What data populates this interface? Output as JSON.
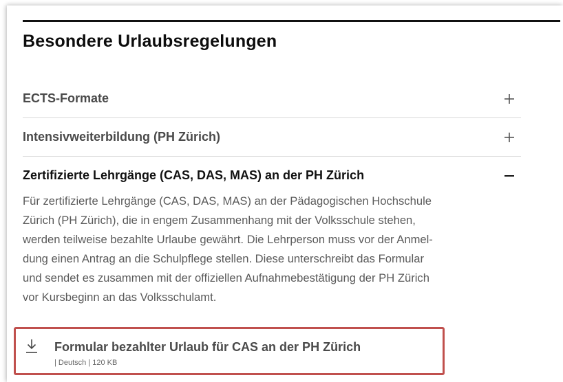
{
  "section": {
    "title": "Besondere Urlaubsregelungen"
  },
  "accordion": {
    "items": [
      {
        "label": "ECTS-Formate",
        "state": "collapsed",
        "toggle_icon": "plus-icon"
      },
      {
        "label": "Intensivweiterbildung (PH Zürich)",
        "state": "collapsed",
        "toggle_icon": "plus-icon"
      },
      {
        "label": "Zertifizierte Lehrgänge (CAS, DAS, MAS) an der PH Zürich",
        "state": "expanded",
        "toggle_icon": "minus-icon",
        "body_lines": [
          "Für zertifizierte Lehrgänge (CAS, DAS, MAS) an der Pädagogischen Hochschule",
          "Zürich (PH Zürich), die in engem Zusammenhang mit der Volksschule stehen,",
          "werden teilweise bezahlte Urlaube gewährt. Die Lehrperson muss vor der Anmel-",
          "dung einen Antrag an die Schulpflege stellen. Diese unterschreibt das Formular",
          "und sendet es zusammen mit der offiziellen Aufnahmebestätigung der PH Zürich",
          "vor Kursbeginn an das Volksschulamt."
        ]
      }
    ]
  },
  "download": {
    "title": "Formular bezahlter Urlaub für CAS an der PH Zürich",
    "meta": "| Deutsch | 120 KB",
    "icon": "download-icon",
    "highlight_color": "#c0504d"
  }
}
